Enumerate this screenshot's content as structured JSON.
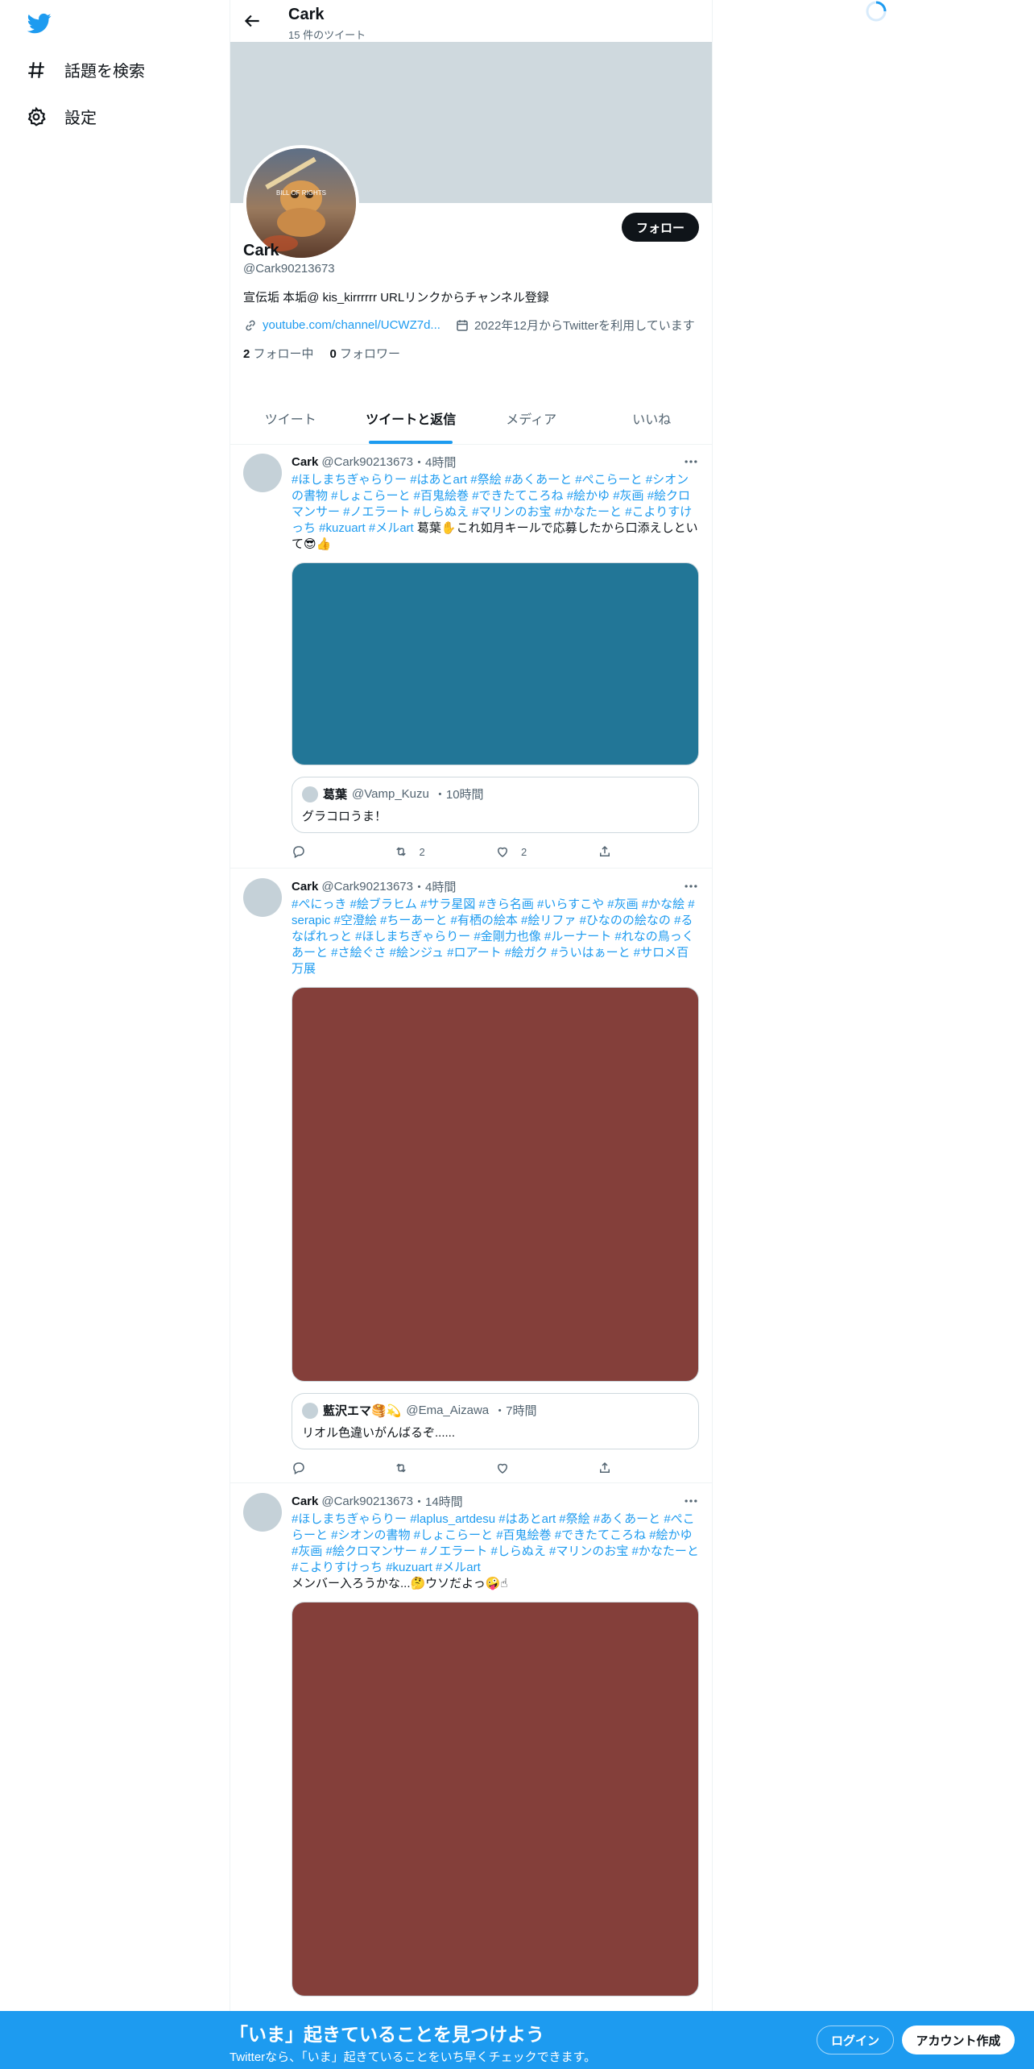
{
  "nav": {
    "explore_label": "話題を検索",
    "settings_label": "設定",
    "icons": [
      "twitter-bird-icon",
      "hashtag-icon",
      "gear-icon"
    ]
  },
  "header": {
    "name": "Cark",
    "tweet_count": "15 件のツイート"
  },
  "profile": {
    "avatar_caption": "BILL OF RIGHTS",
    "follow_label": "フォロー",
    "name": "Cark",
    "handle": "@Cark90213673",
    "bio": "宣伝垢 本垢@ kis_kirrrrrr URLリンクからチャンネル登録",
    "link_text": "youtube.com/channel/UCWZ7d...",
    "joined_text": "2022年12月からTwitterを利用しています",
    "following_count": "2",
    "following_label": "フォロー中",
    "followers_count": "0",
    "followers_label": "フォロワー"
  },
  "tabs": [
    {
      "label": "ツイート"
    },
    {
      "label": "ツイートと返信",
      "active": true
    },
    {
      "label": "メディア"
    },
    {
      "label": "いいね"
    }
  ],
  "tweets": [
    {
      "name": "Cark",
      "handle": "@Cark90213673",
      "time": "・4時間",
      "hashtags": "#ほしまちぎゃらりー #はあとart #祭絵 #あくあーと #ぺこらーと #シオンの書物 #しょこらーと #百鬼絵巻 #できたてころね #絵かゆ #灰画 #絵クロマンサー #ノエラート #しらぬえ #マリンのお宝 #かなたーと #こよりすけっち #kuzuart #メルart",
      "text": " 葛葉✋これ如月キールで応募したから口添えしといて😎👍",
      "media_color": "#227697",
      "quote": {
        "name": "葛葉",
        "handle": "@Vamp_Kuzu",
        "time": "・10時間",
        "text": "グラコロうま！"
      },
      "reply_count": "",
      "retweet_count": "2",
      "like_count": "2"
    },
    {
      "name": "Cark",
      "handle": "@Cark90213673",
      "time": "・4時間",
      "hashtags": "#ぺにっき #絵ブラヒム #サラ星図 #きら名画 #いらすこや #灰画 #かな絵 #serapic #空澄絵 #ちーあーと #有栖の絵本 #絵リファ #ひなのの絵なの #るなぱれっと #ほしまちぎゃらりー #金剛力也像 #ルーナート #れなの鳥っくあーと #さ絵ぐさ #絵ンジュ #ロアート #絵ガク #ういはぁーと #サロメ百万展",
      "text": "",
      "media_color": "#843f3a",
      "quote": {
        "name": "藍沢エマ🥞💫",
        "handle": "@Ema_Aizawa",
        "time": "・7時間",
        "text": "リオル色違いがんばるぞ......"
      },
      "reply_count": "",
      "retweet_count": "",
      "like_count": ""
    },
    {
      "name": "Cark",
      "handle": "@Cark90213673",
      "time": "・14時間",
      "hashtags": "#ほしまちぎゃらりー #laplus_artdesu #はあとart #祭絵 #あくあーと #ぺこらーと #シオンの書物 #しょこらーと #百鬼絵巻 #できたてころね #絵かゆ #灰画 #絵クロマンサー #ノエラート #しらぬえ #マリンのお宝 #かなたーと #こよりすけっち #kuzuart #メルart",
      "text": "メンバー入ろうかな...🤔ウソだよっ🤪☝",
      "media_color": "#843f3a"
    }
  ],
  "bottom_bar": {
    "title": "「いま」起きていることを見つけよう",
    "subtitle": "Twitterなら、「いま」起きていることをいち早くチェックできます。",
    "login_label": "ログイン",
    "signup_label": "アカウント作成"
  },
  "colors": {
    "accent": "#1d9bf0",
    "banner": "#cfd9de",
    "bottom_bar": "#1d9bf0"
  }
}
